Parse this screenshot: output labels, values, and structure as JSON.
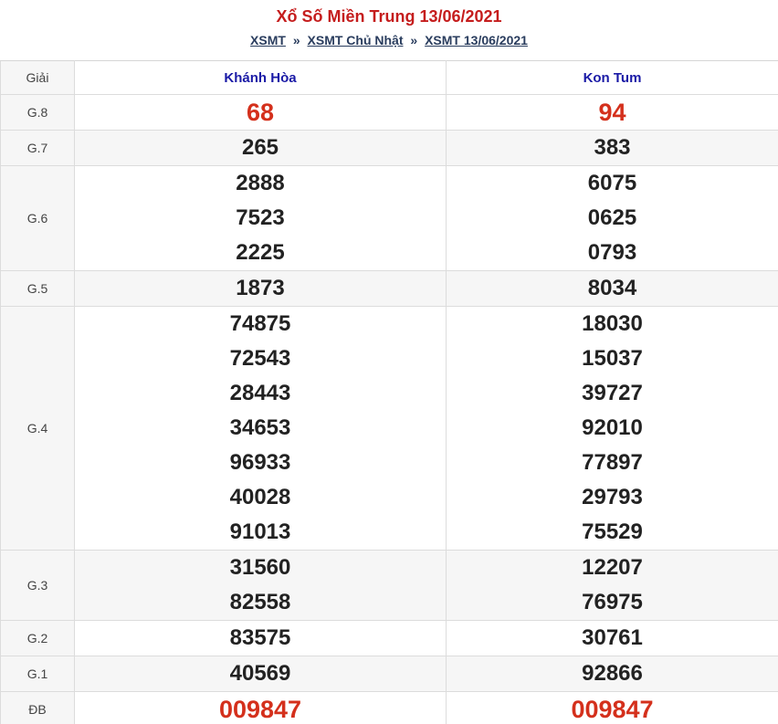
{
  "header": {
    "title": "Xổ Số Miền Trung 13/06/2021",
    "breadcrumb": [
      {
        "label": "XSMT"
      },
      {
        "label": "XSMT Chủ Nhật"
      },
      {
        "label": "XSMT 13/06/2021"
      }
    ],
    "separator": "»"
  },
  "table": {
    "label_header": "Giải",
    "provinces": [
      "Khánh Hòa",
      "Kon Tum"
    ],
    "prizes": [
      {
        "label": "G.8",
        "a": [
          "68"
        ],
        "b": [
          "94"
        ]
      },
      {
        "label": "G.7",
        "a": [
          "265"
        ],
        "b": [
          "383"
        ]
      },
      {
        "label": "G.6",
        "a": [
          "2888",
          "7523",
          "2225"
        ],
        "b": [
          "6075",
          "0625",
          "0793"
        ]
      },
      {
        "label": "G.5",
        "a": [
          "1873"
        ],
        "b": [
          "8034"
        ]
      },
      {
        "label": "G.4",
        "a": [
          "74875",
          "72543",
          "28443",
          "34653",
          "96933",
          "40028",
          "91013"
        ],
        "b": [
          "18030",
          "15037",
          "39727",
          "92010",
          "77897",
          "29793",
          "75529"
        ]
      },
      {
        "label": "G.3",
        "a": [
          "31560",
          "82558"
        ],
        "b": [
          "12207",
          "76975"
        ]
      },
      {
        "label": "G.2",
        "a": [
          "83575"
        ],
        "b": [
          "30761"
        ]
      },
      {
        "label": "G.1",
        "a": [
          "40569"
        ],
        "b": [
          "92866"
        ]
      },
      {
        "label": "ĐB",
        "a": [
          "009847"
        ],
        "b": [
          "009847"
        ]
      }
    ]
  },
  "colors": {
    "title": "#c51d1d",
    "province_header": "#1a1aa6",
    "highlight_number": "#d4301c",
    "link": "#2a3d5e"
  }
}
